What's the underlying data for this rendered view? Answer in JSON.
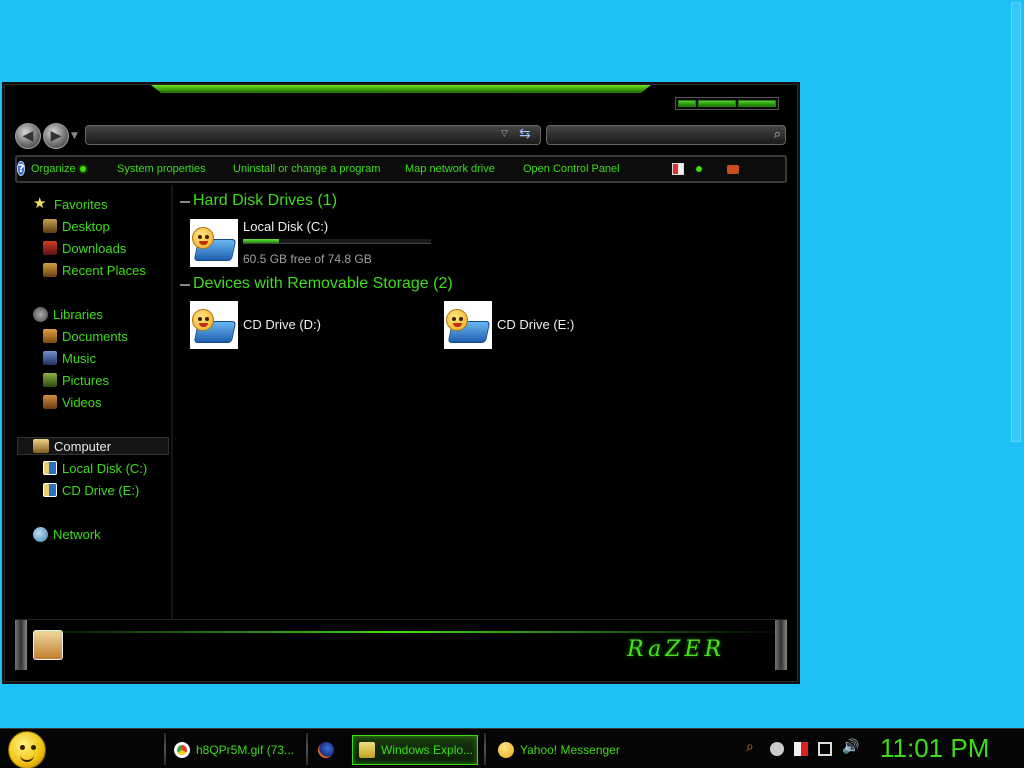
{
  "window": {
    "toolbar": {
      "organize": "Organize",
      "system_properties": "System properties",
      "uninstall": "Uninstall or change a program",
      "map_drive": "Map network drive",
      "control_panel": "Open Control Panel",
      "help": "?"
    },
    "navigation": {
      "favorites": "Favorites",
      "desktop": "Desktop",
      "downloads": "Downloads",
      "recent_places": "Recent Places",
      "libraries": "Libraries",
      "documents": "Documents",
      "music": "Music",
      "pictures": "Pictures",
      "videos": "Videos",
      "computer": "Computer",
      "local_disk_c": "Local Disk (C:)",
      "cd_drive_e": "CD Drive (E:)",
      "network": "Network"
    },
    "content": {
      "hard_disk_header": "Hard Disk Drives (1)",
      "removable_header": "Devices with Removable Storage (2)",
      "local_disk": {
        "name": "Local Disk (C:)",
        "free_text": "60.5 GB free of 74.8 GB",
        "used_fraction": 0.19
      },
      "cd_d": "CD Drive (D:)",
      "cd_e": "CD Drive (E:)"
    },
    "brand": "RaZER"
  },
  "taskbar": {
    "items": [
      {
        "label": "h8QPr5M.gif (73...",
        "icon": "chrome-icon"
      },
      {
        "label": "",
        "icon": "firefox-icon"
      },
      {
        "label": "Windows Explo...",
        "icon": "folder-icon",
        "active": true
      },
      {
        "label": "Yahoo! Messenger",
        "icon": "yahoo-messenger-icon"
      }
    ],
    "clock": "11:01 PM"
  },
  "colors": {
    "accent": "#3ddc1a",
    "desktop": "#1ec0f6",
    "window_bg": "#000000"
  }
}
